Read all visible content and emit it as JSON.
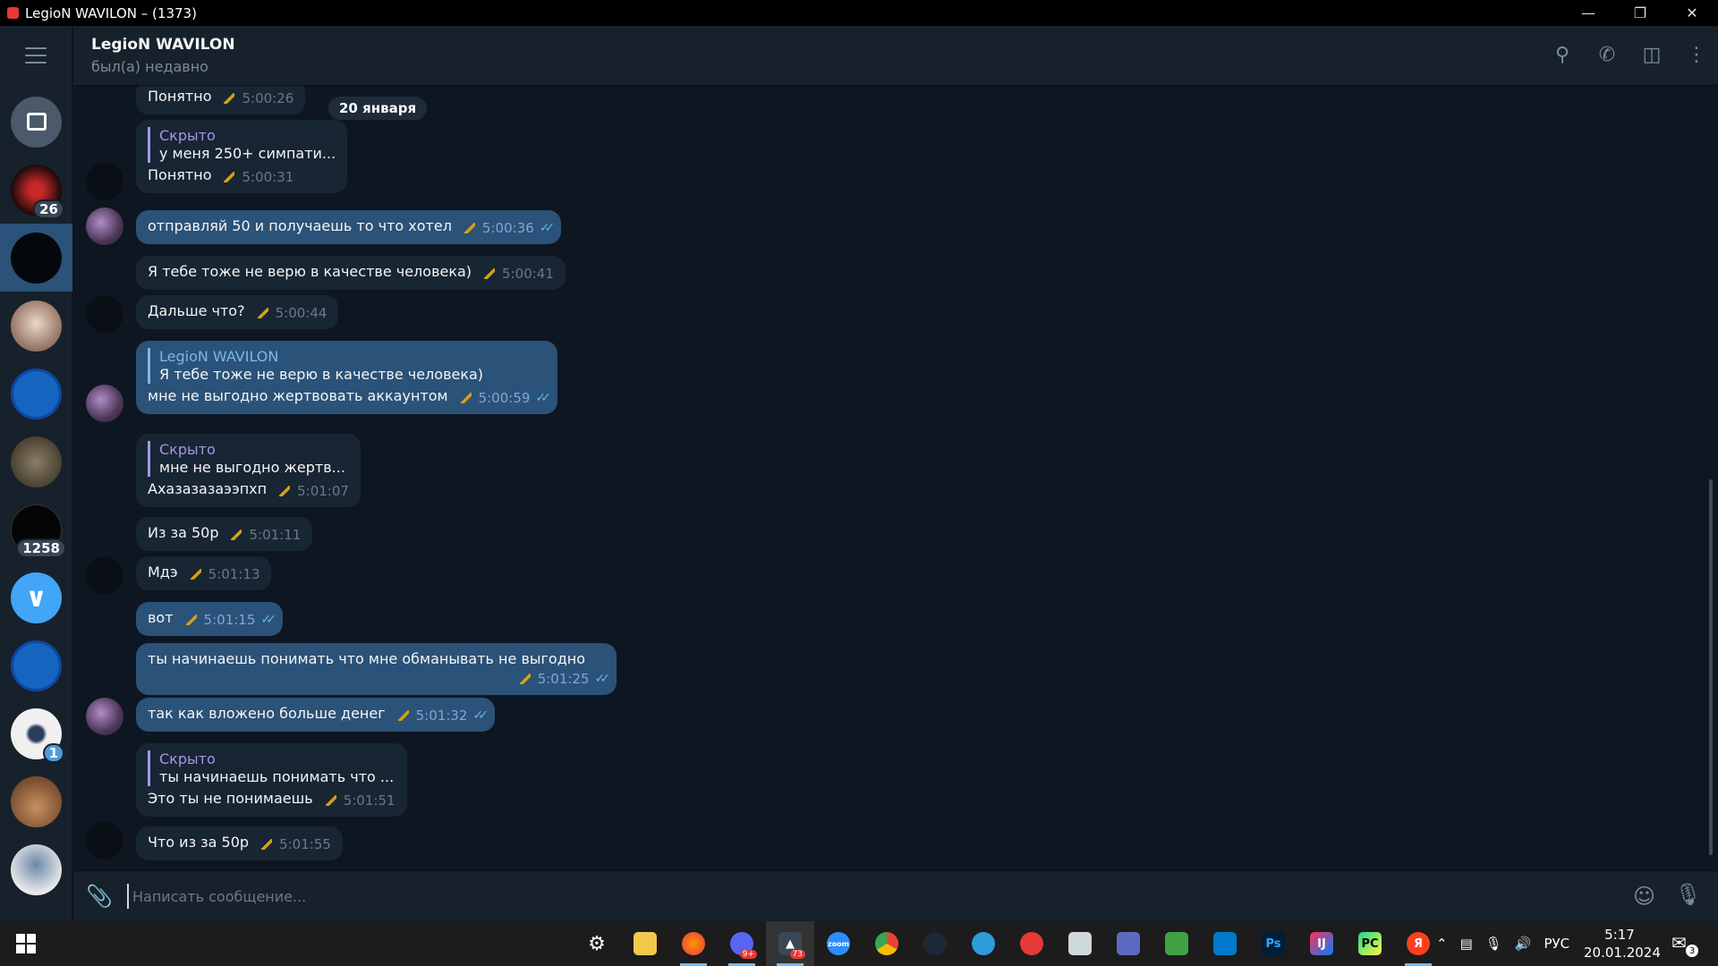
{
  "window": {
    "title": "LegioN WAVILON – (1373)"
  },
  "chat": {
    "name": "LegioN WAVILON",
    "status": "был(а) недавно"
  },
  "sidebar": {
    "badges": {
      "netflix": "26",
      "vpn": "1258",
      "bot": "1"
    }
  },
  "date_separator": "20 января",
  "messages": [
    {
      "text": "Понятно",
      "time": "5:00:26"
    },
    {
      "reply_name": "Скрыто",
      "reply_text": "у меня 250+ симпати...",
      "text": "Понятно",
      "time": "5:00:31"
    },
    {
      "text": "отправляй 50 и получаешь то что хотел",
      "time": "5:00:36"
    },
    {
      "text": "Я тебе тоже не верю в качестве человека)",
      "time": "5:00:41"
    },
    {
      "text": "Дальше что?",
      "time": "5:00:44"
    },
    {
      "reply_name": "LegioN WAVILON",
      "reply_text": "Я тебе тоже не верю в качестве человека)",
      "text": "мне не выгодно жертвовать аккаунтом",
      "time": "5:00:59"
    },
    {
      "reply_name": "Скрыто",
      "reply_text": "мне не выгодно жертв...",
      "text": "Ахазазазаээпхп",
      "time": "5:01:07"
    },
    {
      "text": "Из за 50р",
      "time": "5:01:11"
    },
    {
      "text": "Мдэ",
      "time": "5:01:13"
    },
    {
      "text": "вот",
      "time": "5:01:15"
    },
    {
      "text": "ты начинаешь понимать что мне обманывать не выгодно",
      "time": "5:01:25"
    },
    {
      "text": "так как вложено больше денег",
      "time": "5:01:32"
    },
    {
      "reply_name": "Скрыто",
      "reply_text": "ты начинаешь понимать что ...",
      "text": "Это ты не понимаешь",
      "time": "5:01:51"
    },
    {
      "text": "Что из за 50р",
      "time": "5:01:55"
    }
  ],
  "composer": {
    "placeholder": "Написать сообщение..."
  },
  "taskbar": {
    "lang": "РУС",
    "time": "5:17",
    "date": "20.01.2024",
    "notifications": "3",
    "discord_badge": "9+",
    "app_badge": "73"
  },
  "icons": {
    "menu": "hamburger-icon",
    "search": "search-icon",
    "call": "phone-icon",
    "panel": "sidebar-toggle-icon",
    "more": "more-vertical-icon",
    "attach": "paperclip-icon",
    "emoji": "emoji-icon",
    "mic": "microphone-icon"
  },
  "colors": {
    "outgoing": "#2b5278",
    "incoming": "#182533",
    "background": "#0e1621",
    "reply_accent": "#a695e7"
  }
}
